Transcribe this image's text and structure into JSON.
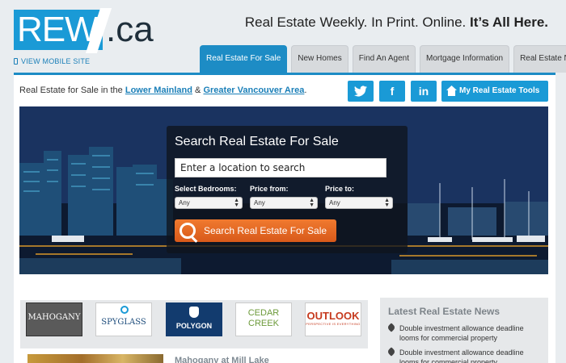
{
  "header": {
    "logo_rew": "REW",
    "logo_ca": ".ca",
    "mobile_link": "VIEW MOBILE SITE",
    "tagline_prefix": "Real Estate Weekly. In Print. Online.",
    "tagline_bold": "It’s All Here."
  },
  "tabs": [
    {
      "label": "Real Estate For Sale",
      "active": true
    },
    {
      "label": "New Homes"
    },
    {
      "label": "Find An Agent"
    },
    {
      "label": "Mortgage Information"
    },
    {
      "label": "Real Estate News"
    }
  ],
  "crumb": {
    "prefix": "Real Estate for Sale in the",
    "link1": "Lower Mainland",
    "amp": "&",
    "link2": "Greater Vancouver Area",
    "suffix": "."
  },
  "social": {
    "twitter": "twitter-icon",
    "facebook": "f",
    "linkedin": "in",
    "tools_label": "My Real Estate Tools"
  },
  "search": {
    "title": "Search Real Estate For Sale",
    "location_placeholder": "Enter a location to search",
    "bedrooms_label": "Select Bedrooms:",
    "price_from_label": "Price from:",
    "price_to_label": "Price to:",
    "bedrooms_value": "Any",
    "price_from_value": "Any",
    "price_to_value": "Any",
    "button_label": "Search Real Estate For Sale"
  },
  "brands": [
    {
      "name": "MAHOGANY"
    },
    {
      "name": "SPYGLASS",
      "sub": "AT SUNSTONE"
    },
    {
      "name": "POLYGON"
    },
    {
      "name": "CEDAR",
      "name2": "CREEK"
    },
    {
      "name": "OUTLOOK",
      "sub": "PERSPECTIVE IS EVERYTHING"
    }
  ],
  "listing": {
    "title": "Mahogany at Mill Lake"
  },
  "news": {
    "heading": "Latest Real Estate News",
    "items": [
      "Double investment allowance deadline looms for commercial property",
      "Double investment allowance deadline looms for commercial property"
    ]
  },
  "colors": {
    "accent": "#1a9ad6",
    "tab_active": "#1d8cc5",
    "cta_orange": "#e0651f"
  }
}
